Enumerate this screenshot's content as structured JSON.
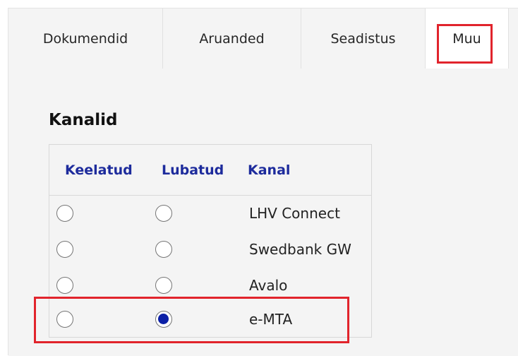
{
  "tabs": [
    {
      "label": "Dokumendid",
      "active": false
    },
    {
      "label": "Aruanded",
      "active": false
    },
    {
      "label": "Seadistus",
      "active": false
    },
    {
      "label": "Muu",
      "active": true
    }
  ],
  "section_title": "Kanalid",
  "table": {
    "headers": [
      "Keelatud",
      "Lubatud",
      "Kanal"
    ],
    "rows": [
      {
        "kanal": "LHV Connect",
        "keelatud": false,
        "lubatud": false
      },
      {
        "kanal": "Swedbank GW",
        "keelatud": false,
        "lubatud": false
      },
      {
        "kanal": "Avalo",
        "keelatud": false,
        "lubatud": false
      },
      {
        "kanal": "e-MTA",
        "keelatud": false,
        "lubatud": true
      }
    ]
  },
  "colors": {
    "header_text": "#1d2b9c",
    "highlight": "#e1242c",
    "radio_checked": "#0b1fa6"
  }
}
